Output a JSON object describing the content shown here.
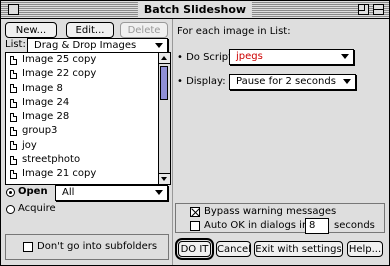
{
  "window": {
    "title": "Batch Slideshow"
  },
  "toolbar": {
    "new_label": "New...",
    "edit_label": "Edit...",
    "delete_label": "Delete"
  },
  "list_selector": {
    "label": "List:",
    "value": "Drag & Drop Images"
  },
  "files": [
    {
      "name": "Image 25 copy",
      "icon": "document-icon"
    },
    {
      "name": "Image 22 copy",
      "icon": "document-icon"
    },
    {
      "name": "Image 8",
      "icon": "document-icon"
    },
    {
      "name": "Image 24",
      "icon": "document-icon"
    },
    {
      "name": "Image 28",
      "icon": "document-icon"
    },
    {
      "name": "group3",
      "icon": "document-icon"
    },
    {
      "name": "joy",
      "icon": "document-icon"
    },
    {
      "name": "streetphoto",
      "icon": "document-icon"
    },
    {
      "name": "Image 21 copy",
      "icon": "document-icon"
    },
    {
      "name": "Image 7",
      "icon": "document-icon"
    }
  ],
  "mode": {
    "open_label": "Open",
    "acquire_label": "Acquire",
    "selected": "Open",
    "filter_value": "All"
  },
  "subfolders": {
    "label": "Don't go into subfolders",
    "checked": false
  },
  "right": {
    "heading": "For each image in List:",
    "script_label": "Do Script:",
    "script_value": "jpegs",
    "script_color": "#cc0000",
    "display_label": "Display:",
    "display_value": "Pause for 2 seconds"
  },
  "options": {
    "bypass_label": "Bypass warning messages",
    "bypass_checked": true,
    "autook_label": "Auto OK in dialogs in",
    "autook_checked": false,
    "autook_value": "8",
    "autook_unit": "seconds"
  },
  "actions": {
    "doit_label": "DO IT",
    "cancel_label": "Cancel",
    "exit_label": "Exit with settings",
    "help_label": "Help..."
  }
}
